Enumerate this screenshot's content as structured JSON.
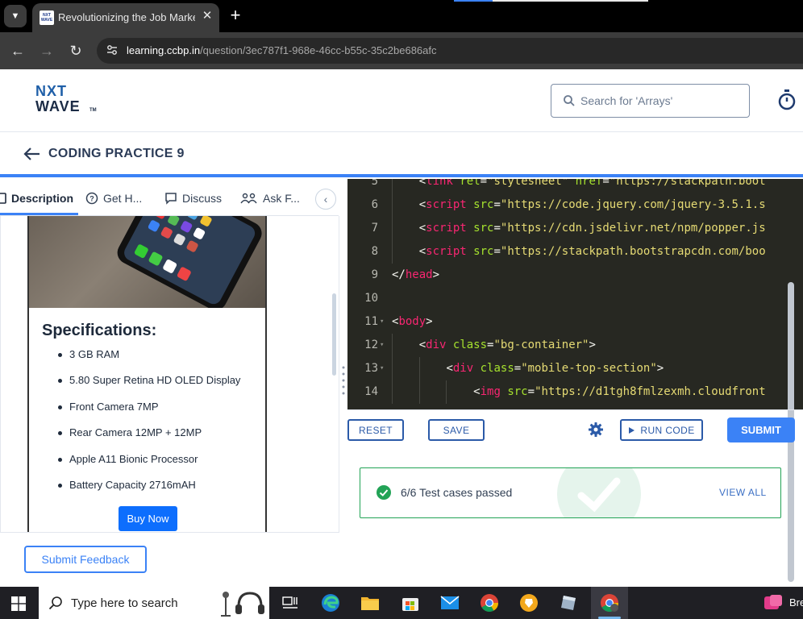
{
  "browser": {
    "tab_title": "Revolutionizing the Job Market",
    "favicon_text": "NXT WAVE",
    "url_host": "learning.ccbp.in",
    "url_path": "/question/3ec787f1-968e-46cc-b55c-35c2be686afc"
  },
  "header": {
    "logo_line1": "NXT",
    "logo_line2": "WAVE",
    "logo_tm": "TM",
    "search_placeholder": "Search for 'Arrays'"
  },
  "page": {
    "title": "CODING PRACTICE 9"
  },
  "left_tabs": [
    {
      "label": "Description"
    },
    {
      "label": "Get H..."
    },
    {
      "label": "Discuss"
    },
    {
      "label": "Ask F..."
    }
  ],
  "preview": {
    "spec_heading": "Specifications:",
    "specs": [
      "3 GB RAM",
      "5.80 Super Retina HD OLED Display",
      "Front Camera 7MP",
      "Rear Camera 12MP + 12MP",
      "Apple A11 Bionic Processor",
      "Battery Capacity 2716mAH"
    ],
    "buy_label": "Buy Now"
  },
  "feedback_label": "Submit Feedback",
  "editor": {
    "lines": [
      {
        "n": "5",
        "fold": "",
        "indent": 1,
        "tokens": [
          [
            "pn",
            "<"
          ],
          [
            "tg",
            "link"
          ],
          [
            "pn",
            " "
          ],
          [
            "at",
            "rel"
          ],
          [
            "pn",
            "="
          ],
          [
            "st",
            "\"stylesheet\""
          ],
          [
            "pn",
            " "
          ],
          [
            "at",
            "href"
          ],
          [
            "pn",
            "="
          ],
          [
            "st",
            "\"https://stackpath.boot"
          ]
        ]
      },
      {
        "n": "6",
        "fold": "",
        "indent": 1,
        "tokens": [
          [
            "pn",
            "<"
          ],
          [
            "tg",
            "script"
          ],
          [
            "pn",
            " "
          ],
          [
            "at",
            "src"
          ],
          [
            "pn",
            "="
          ],
          [
            "st",
            "\"https://code.jquery.com/jquery-3.5.1.s"
          ]
        ]
      },
      {
        "n": "7",
        "fold": "",
        "indent": 1,
        "tokens": [
          [
            "pn",
            "<"
          ],
          [
            "tg",
            "script"
          ],
          [
            "pn",
            " "
          ],
          [
            "at",
            "src"
          ],
          [
            "pn",
            "="
          ],
          [
            "st",
            "\"https://cdn.jsdelivr.net/npm/popper.js"
          ]
        ]
      },
      {
        "n": "8",
        "fold": "",
        "indent": 1,
        "tokens": [
          [
            "pn",
            "<"
          ],
          [
            "tg",
            "script"
          ],
          [
            "pn",
            " "
          ],
          [
            "at",
            "src"
          ],
          [
            "pn",
            "="
          ],
          [
            "st",
            "\"https://stackpath.bootstrapcdn.com/boo"
          ]
        ]
      },
      {
        "n": "9",
        "fold": "",
        "indent": 0,
        "tokens": [
          [
            "pn",
            "</"
          ],
          [
            "tg",
            "head"
          ],
          [
            "pn",
            ">"
          ]
        ]
      },
      {
        "n": "10",
        "fold": "",
        "indent": 0,
        "tokens": []
      },
      {
        "n": "11",
        "fold": "▾",
        "indent": 0,
        "tokens": [
          [
            "pn",
            "<"
          ],
          [
            "tg",
            "body"
          ],
          [
            "pn",
            ">"
          ]
        ]
      },
      {
        "n": "12",
        "fold": "▾",
        "indent": 1,
        "tokens": [
          [
            "pn",
            "<"
          ],
          [
            "tg",
            "div"
          ],
          [
            "pn",
            " "
          ],
          [
            "at",
            "class"
          ],
          [
            "pn",
            "="
          ],
          [
            "st",
            "\"bg-container\""
          ],
          [
            "pn",
            ">"
          ]
        ]
      },
      {
        "n": "13",
        "fold": "▾",
        "indent": 2,
        "tokens": [
          [
            "pn",
            "<"
          ],
          [
            "tg",
            "div"
          ],
          [
            "pn",
            " "
          ],
          [
            "at",
            "class"
          ],
          [
            "pn",
            "="
          ],
          [
            "st",
            "\"mobile-top-section\""
          ],
          [
            "pn",
            ">"
          ]
        ]
      },
      {
        "n": "14",
        "fold": "",
        "indent": 3,
        "tokens": [
          [
            "pn",
            "<"
          ],
          [
            "tg",
            "img"
          ],
          [
            "pn",
            " "
          ],
          [
            "at",
            "src"
          ],
          [
            "pn",
            "="
          ],
          [
            "st",
            "\"https://d1tgh8fmlzexmh.cloudfront"
          ]
        ]
      }
    ]
  },
  "toolbar": {
    "reset_label": "RESET",
    "save_label": "SAVE",
    "run_label": "RUN CODE",
    "submit_label": "SUBMIT"
  },
  "result": {
    "text": "6/6 Test cases passed",
    "view_all": "VIEW ALL"
  },
  "taskbar": {
    "search_placeholder": "Type here to search",
    "tray_text": "Bre"
  },
  "colors": {
    "accent": "#3b82f6",
    "success": "#22a356",
    "editor_bg": "#272822"
  }
}
